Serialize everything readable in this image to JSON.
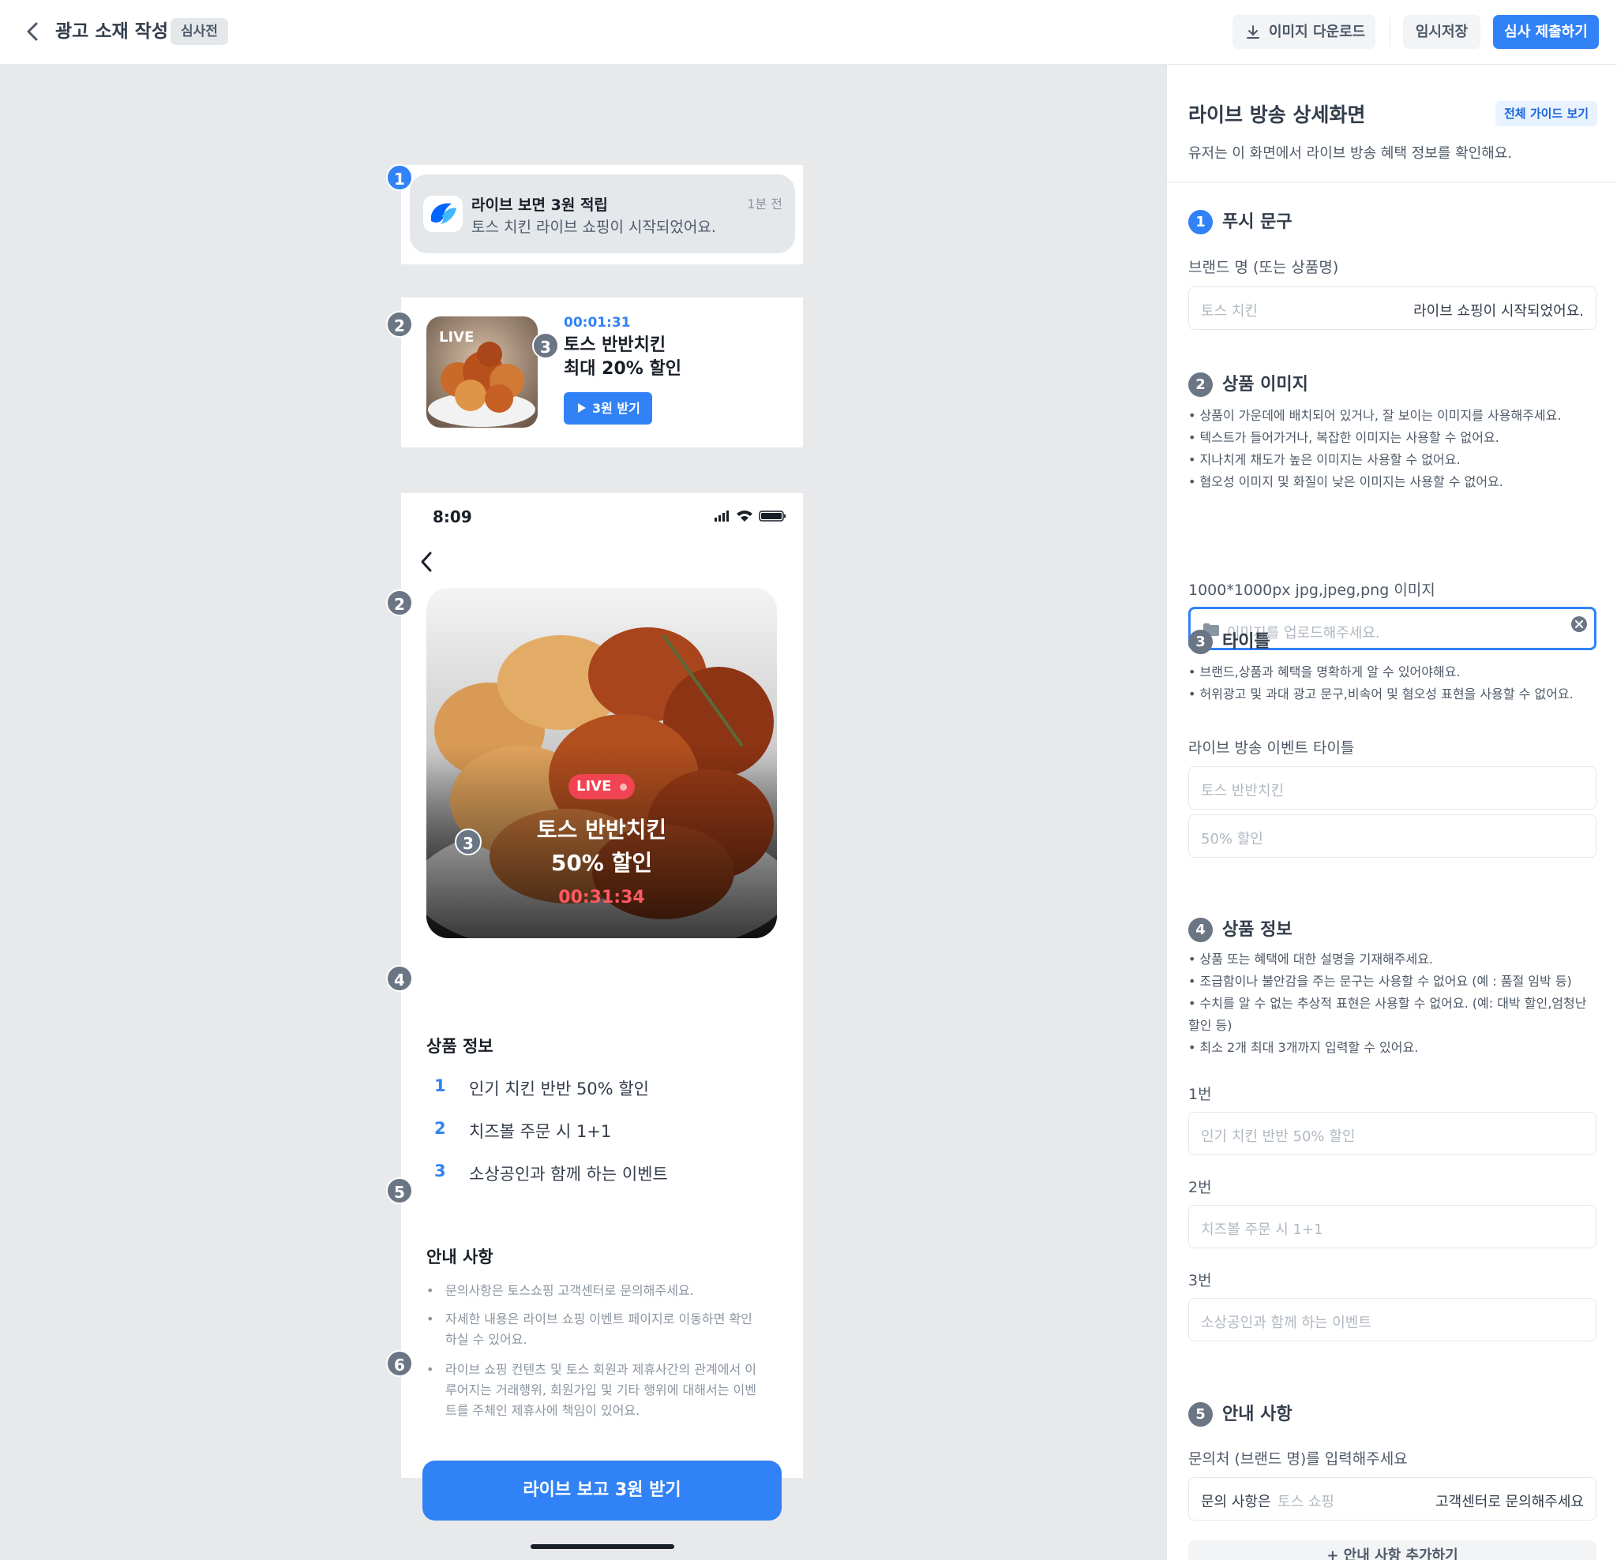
{
  "topbar": {
    "title": "광고 소재 작성",
    "status_badge": "심사전",
    "download_label": "이미지 다운로드",
    "save_label": "임시저장",
    "submit_label": "심사 제출하기"
  },
  "preview": {
    "markers": [
      "1",
      "2",
      "3",
      "4",
      "5",
      "6"
    ],
    "push": {
      "title": "라이브 보면 3원 적립",
      "body": "토스 치킨 라이브 쇼핑이 시작되었어요.",
      "time": "1분 전"
    },
    "banner": {
      "live_badge": "LIVE",
      "timer": "00:01:31",
      "title_line1": "토스 반반치킨",
      "title_line2": "최대 20% 할인",
      "button_label": "3원 받기"
    },
    "phone": {
      "status_time": "8:09",
      "hero_live_badge": "LIVE",
      "hero_title_line1": "토스 반반치킨",
      "hero_title_line2": "50% 할인",
      "hero_timer": "00:31:34",
      "product_section_title": "상품 정보",
      "product_items": [
        {
          "num": "1",
          "text": "인기 치킨 반반 50% 할인"
        },
        {
          "num": "2",
          "text": "치즈볼 주문 시 1+1"
        },
        {
          "num": "3",
          "text": "소상공인과 함께 하는 이벤트"
        }
      ],
      "notice_section_title": "안내 사항",
      "notices": [
        "문의사항은 토스쇼핑 고객센터로 문의해주세요.",
        "자세한 내용은 라이브 쇼핑 이벤트 페이지로 이동하면 확인하실 수 있어요.",
        "라이브 쇼핑 컨텐츠 및 토스 회원과 제휴사간의 관계에서 이루어지는 거래행위, 회원가입 및 기타 행위에 대해서는 이벤트를 주체인 제휴사에 책임이 있어요."
      ],
      "cta_label": "라이브 보고 3원 받기"
    }
  },
  "panel": {
    "title": "라이브 방송 상세화면",
    "guide_label": "전체 가이드 보기",
    "description": "유저는 이 화면에서 라이브 방송 혜택 정보를 확인해요.",
    "push": {
      "num": "1",
      "heading": "푸시 문구",
      "label": "브랜드 명 (또는 상품명)",
      "placeholder": "토스 치킨",
      "suffix": "라이브 쇼핑이 시작되었어요."
    },
    "image": {
      "num": "2",
      "heading": "상품 이미지",
      "bullets": [
        "• 상품이 가운데에 배치되어 있거나, 잘 보이는 이미지를 사용해주세요.",
        "• 텍스트가 들어가거나, 복잡한 이미지는 사용할 수 없어요.",
        "• 지나치게 채도가 높은 이미지는 사용할 수 없어요.",
        "• 혐오성 이미지 및 화질이 낮은 이미지는 사용할 수 없어요."
      ],
      "label": "1000*1000px jpg,jpeg,png 이미지",
      "placeholder": "이미지를 업로드해주세요."
    },
    "title_section": {
      "num": "3",
      "heading": "타이틀",
      "bullets": [
        "• 브랜드,상품과 혜택을 명확하게 알 수 있어야해요.",
        "• 허위광고 및 과대 광고 문구,비속어 및 혐오성 표현을 사용할 수 없어요."
      ],
      "label": "라이브 방송 이벤트 타이틀",
      "placeholder1": "토스 반반치킨",
      "placeholder2": "50% 할인"
    },
    "product": {
      "num": "4",
      "heading": "상품 정보",
      "bullets": [
        "• 상품 또는 혜택에 대한 설명을 기재해주세요.",
        "• 조급함이나 불안감을 주는 문구는 사용할 수 없어요 (예 : 품절 임박 등)",
        "• 수치를 알 수 없는 추상적 표현은 사용할 수 없어요. (예: 대박 할인,엄청난 할인 등)",
        "• 최소 2개 최대 3개까지 입력할 수 있어요."
      ],
      "fields": [
        {
          "label": "1번",
          "placeholder": "인기 치킨 반반 50% 할인"
        },
        {
          "label": "2번",
          "placeholder": "치즈볼 주문 시 1+1"
        },
        {
          "label": "3번",
          "placeholder": "소상공인과 함께 하는 이벤트"
        }
      ]
    },
    "notice": {
      "num": "5",
      "heading": "안내 사항",
      "label": "문의처 (브랜드 명)를 입력해주세요",
      "prefix": "문의 사항은",
      "placeholder": "토스 쇼핑",
      "suffix": "고객센터로 문의해주세요",
      "add_label": "+ 안내 사항 추가하기"
    }
  },
  "colors": {
    "accent": "#3182f6",
    "live_red": "#f04452",
    "canvas_bg": "#e8e9eb"
  }
}
